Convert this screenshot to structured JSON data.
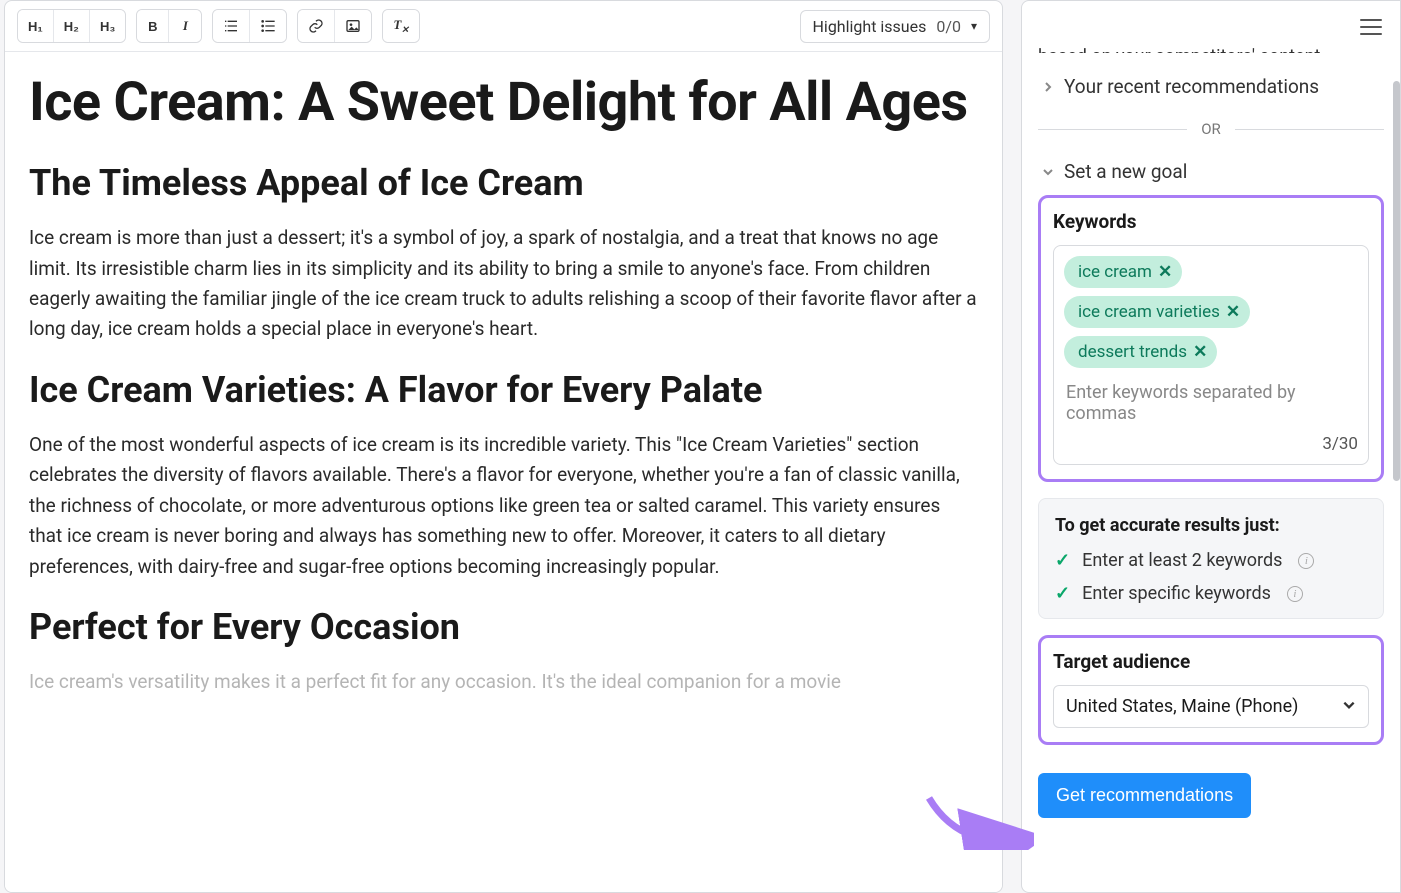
{
  "toolbar": {
    "h1": "H₁",
    "h2": "H₂",
    "h3": "H₃",
    "bold": "B",
    "italic": "I",
    "highlight_label": "Highlight issues",
    "highlight_count": "0/0"
  },
  "article": {
    "title": "Ice Cream: A Sweet Delight for All Ages",
    "h2_1": "The Timeless Appeal of Ice Cream",
    "p1": "Ice cream is more than just a dessert; it's a symbol of joy, a spark of nostalgia, and a treat that knows no age limit. Its irresistible charm lies in its simplicity and its ability to bring a smile to anyone's face. From children eagerly awaiting the familiar jingle of the ice cream truck to adults relishing a scoop of their favorite flavor after a long day, ice cream holds a special place in everyone's heart.",
    "h2_2": "Ice Cream Varieties: A Flavor for Every Palate",
    "p2": "One of the most wonderful aspects of ice cream is its incredible variety. This \"Ice Cream Varieties\" section celebrates the diversity of flavors available. There's a flavor for everyone, whether you're a fan of classic vanilla, the richness of chocolate, or more adventurous options like green tea or salted caramel. This variety ensures that ice cream is never boring and always has something new to offer. Moreover, it caters to all dietary preferences, with dairy-free and sugar-free options becoming increasingly popular.",
    "h2_3": "Perfect for Every Occasion",
    "p3": "Ice cream's versatility makes it a perfect fit for any occasion. It's the ideal companion for a movie"
  },
  "sidebar": {
    "clipped_text": "based on your competitors' content.",
    "recent_recs": "Your recent recommendations",
    "or": "OR",
    "new_goal": "Set a new goal",
    "keywords": {
      "title": "Keywords",
      "chips": [
        "ice cream",
        "ice cream varieties",
        "dessert trends"
      ],
      "placeholder": "Enter keywords separated by commas",
      "counter": "3/30"
    },
    "tips": {
      "title": "To get accurate results just:",
      "items": [
        "Enter at least 2 keywords",
        "Enter specific keywords"
      ]
    },
    "audience": {
      "title": "Target audience",
      "value": "United States, Maine (Phone)"
    },
    "cta": "Get recommendations"
  }
}
